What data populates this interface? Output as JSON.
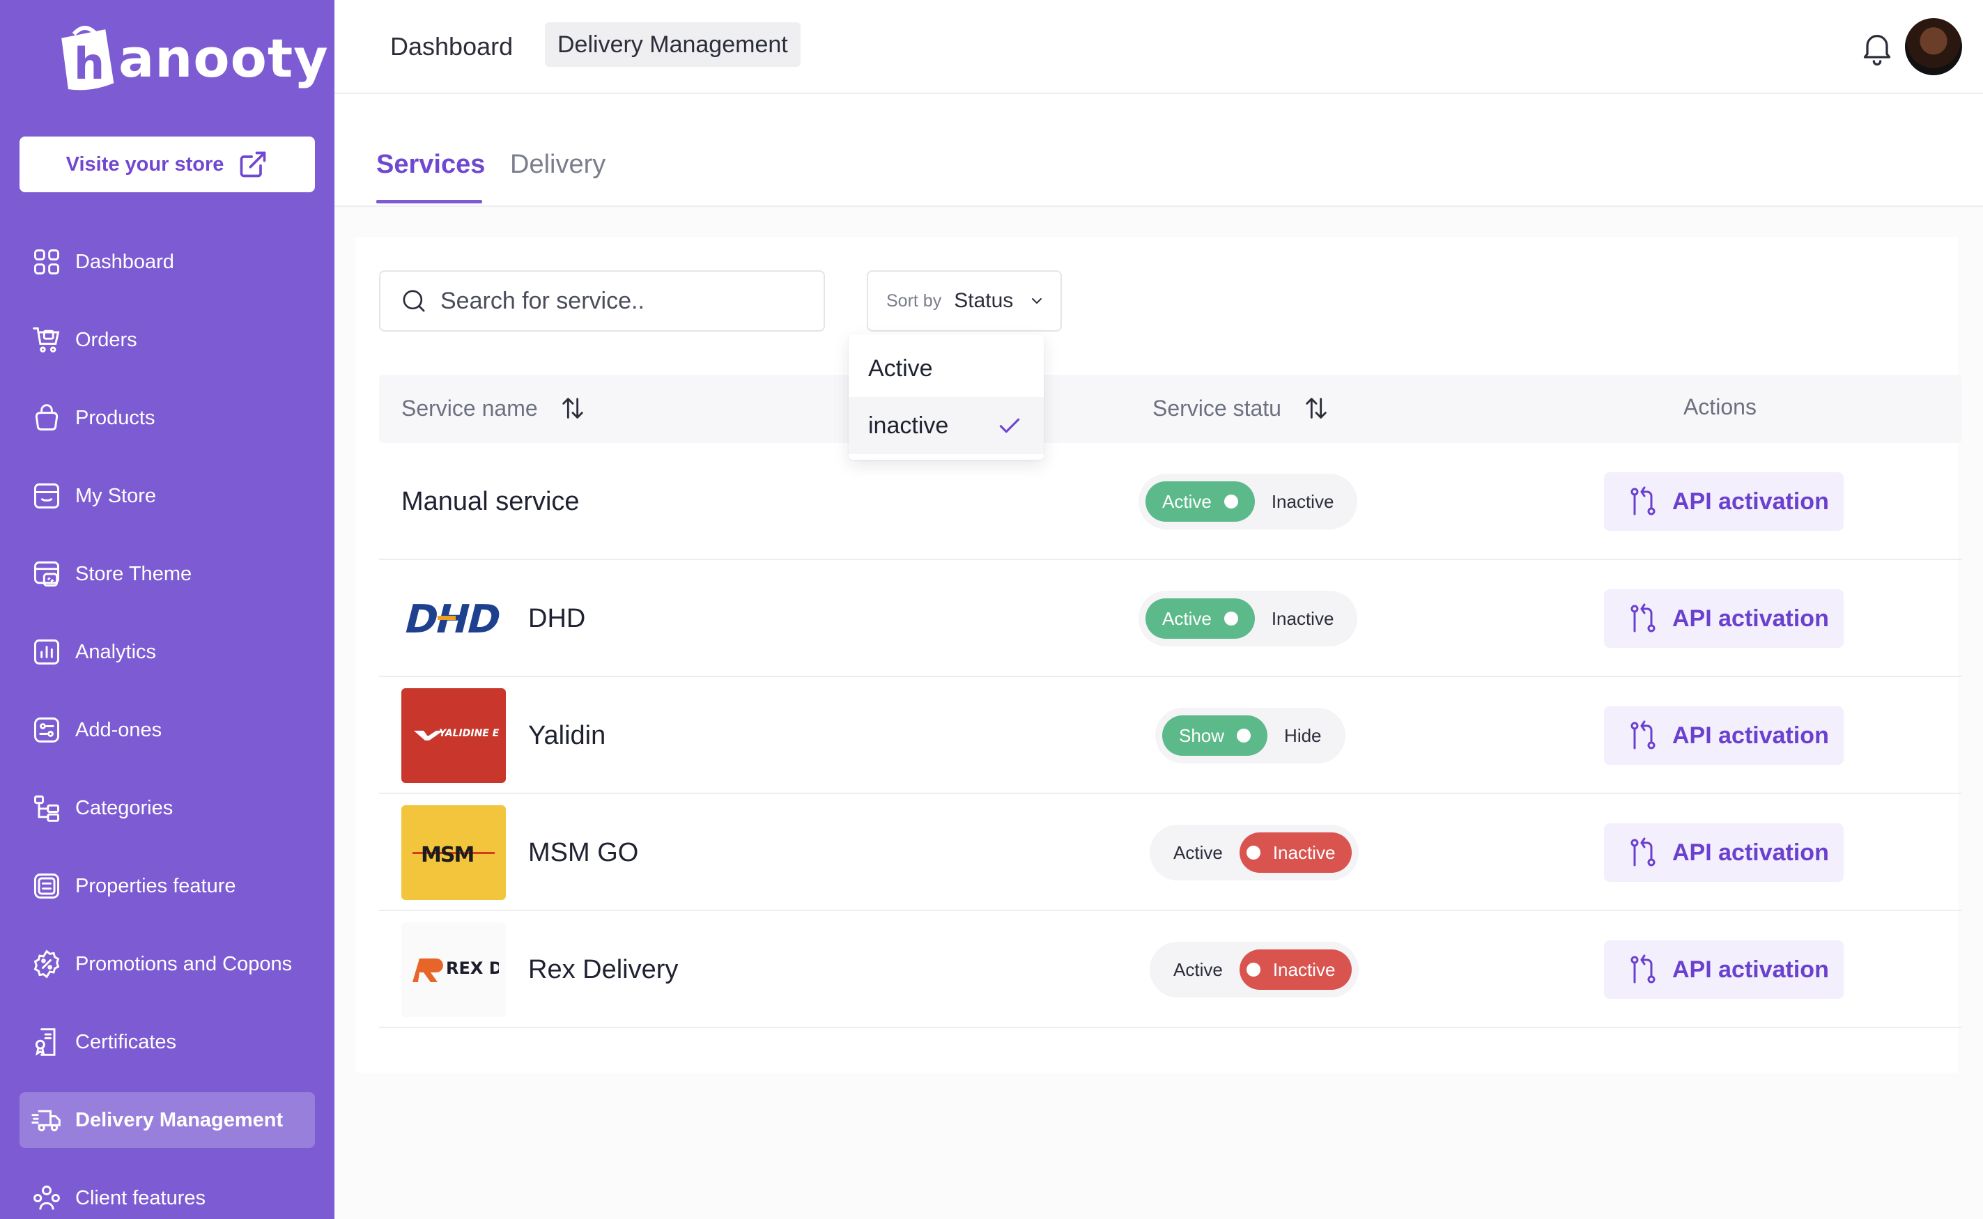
{
  "brand": {
    "name": "anooty",
    "mark_letter": "h",
    "accent": "#7d5bd3",
    "accent_dark": "#7047d1"
  },
  "sidebar": {
    "visit_store_label": "Visite your store",
    "items": [
      {
        "label": "Dashboard",
        "icon": "dashboard-grid-icon"
      },
      {
        "label": "Orders",
        "icon": "cart-icon"
      },
      {
        "label": "Products",
        "icon": "bag-icon"
      },
      {
        "label": "My Store",
        "icon": "store-icon"
      },
      {
        "label": "Store Theme",
        "icon": "theme-icon"
      },
      {
        "label": "Analytics",
        "icon": "analytics-icon"
      },
      {
        "label": "Add-ones",
        "icon": "addons-icon"
      },
      {
        "label": "Categories",
        "icon": "categories-icon"
      },
      {
        "label": "Properties feature",
        "icon": "properties-icon"
      },
      {
        "label": "Promotions and Copons",
        "icon": "promotion-icon"
      },
      {
        "label": "Certificates",
        "icon": "certificate-icon"
      },
      {
        "label": "Delivery Management",
        "icon": "delivery-truck-icon",
        "active": true
      },
      {
        "label": "Client features",
        "icon": "users-icon"
      }
    ]
  },
  "header": {
    "breadcrumb": [
      "Dashboard",
      "Delivery Management"
    ]
  },
  "tabs": [
    "Services",
    "Delivery"
  ],
  "toolbar": {
    "search_placeholder": "Search for service..",
    "sort_label": "Sort by",
    "sort_value": "Status",
    "sort_options": [
      {
        "label": "Active",
        "selected": false
      },
      {
        "label": "inactive",
        "selected": true
      }
    ]
  },
  "table": {
    "columns": [
      "Service name",
      "Service statu",
      "Actions"
    ],
    "rows": [
      {
        "name": "Manual service",
        "logo": "",
        "toggle": {
          "left": "Active",
          "right": "Inactive",
          "state": "left"
        },
        "action": "API activation"
      },
      {
        "name": "DHD",
        "logo": "DHD",
        "toggle": {
          "left": "Active",
          "right": "Inactive",
          "state": "left"
        },
        "action": "API activation"
      },
      {
        "name": "Yalidin",
        "logo": "YALIDINE EXPRESS",
        "toggle": {
          "left": "Show",
          "right": "Hide",
          "state": "left"
        },
        "action": "API activation"
      },
      {
        "name": "MSM GO",
        "logo": "MSM",
        "toggle": {
          "left": "Active",
          "right": "Inactive",
          "state": "right"
        },
        "action": "API activation"
      },
      {
        "name": "Rex Delivery",
        "logo": "REX DELIVERY",
        "toggle": {
          "left": "Active",
          "right": "Inactive",
          "state": "right"
        },
        "action": "API activation"
      }
    ]
  },
  "colors": {
    "active_green": "#5cb98a",
    "inactive_red": "#d9534f"
  }
}
